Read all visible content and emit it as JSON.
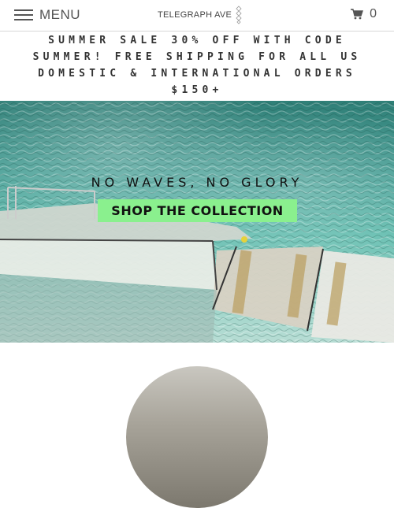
{
  "header": {
    "menu_label": "MENU",
    "logo_text": "TELEGRAPH AVE",
    "cart_count": "0"
  },
  "promo": {
    "lines": [
      "SUMMER SALE 30% OFF WITH CODE",
      "SUMMER! FREE SHIPPING FOR ALL US",
      "DOMESTIC & INTERNATIONAL ORDERS",
      "$150+"
    ]
  },
  "hero": {
    "title": "NO WAVES, NO GLORY",
    "button_label": "SHOP THE COLLECTION",
    "button_color": "#8af08e"
  },
  "icons": {
    "menu": "hamburger-icon",
    "cart": "shopping-cart-icon",
    "logo": "diamond-logo-mark"
  }
}
